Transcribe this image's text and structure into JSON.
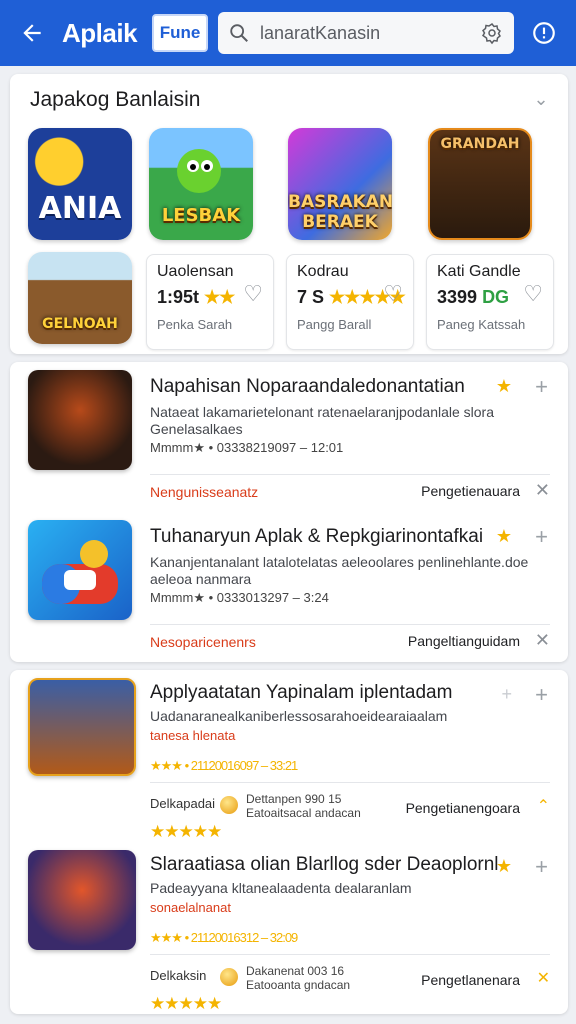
{
  "header": {
    "title": "Aplaik",
    "badge": "Fune",
    "search_placeholder": "lanaratKanasin"
  },
  "featured": {
    "title": "Japakog Banlaisin",
    "tiles": [
      {
        "label": "ANIA"
      },
      {
        "label": "LESBAK"
      },
      {
        "label": "BASRAKAN BERAEK"
      },
      {
        "label": "GRANDAH"
      },
      {
        "label": "GELNOAH"
      }
    ],
    "mini_cards": [
      {
        "name": "Uaolensan",
        "price": "1:95t",
        "stars": "★★",
        "sub": "Penka Sarah"
      },
      {
        "name": "Kodrau",
        "price": "7 S",
        "stars": "★★★★★",
        "sub": "Pangg Barall"
      },
      {
        "name": "Kati Gandle",
        "price": "3399",
        "extra": "DG",
        "sub": "Paneg Katssah"
      }
    ]
  },
  "list1": {
    "items": [
      {
        "title": "Napahisan Noparaandaledonantatian",
        "desc1": "Nataeat lakamarietelonant ratenaelaranjpodanlale slora",
        "desc2": "Genelasalkaes",
        "meta": "Mmmm★ • 03338219097 – 12:01",
        "foot_left": "Nengunisseanatz",
        "foot_right": "Pengetienauara"
      },
      {
        "title": "Tuhanaryun Aplak & Repkgiarinontafkai",
        "desc1": "Kananjentanalant latalotelatas aeleoolares penlinehlante.doe",
        "desc2": "aeleoa nanmara",
        "meta": "Mmmm★ • 0333013297 – 3:24",
        "foot_left": "Nesoparicenenrs",
        "foot_right": "Pangeltianguidam"
      }
    ]
  },
  "list2": {
    "items": [
      {
        "title": "Applyaatatan Yapinalam iplentadam",
        "desc1": "Uadanaranealkaniberlessosarahoeidearaiaalam",
        "sub": "tanesa hlenata",
        "meta": "★★★ • 21120016097 – 33:21",
        "deal_left": "Delkapadai",
        "deal_mid1": "Dettanpen 990 15",
        "deal_mid2": "Eatoaitsacal andacan",
        "deal_right": "Pengetianengoara",
        "stars": "★★★★★"
      },
      {
        "title": "Slaraatiasa olian Blarllog sder Deaoplornl",
        "desc1": "Padeayyana kltanealaadenta dealaranlam",
        "sub": "sonaelalnanat",
        "meta": "★★★ • 21120016312 – 32:09",
        "deal_left": "Delkaksin",
        "deal_mid1": "Dakanenat 003 16",
        "deal_mid2": "Eatooanta gndacan",
        "deal_right": "Pengetlanenara",
        "stars": "★★★★★"
      }
    ]
  },
  "colors": {
    "header_bg": "#1f5fd6",
    "accent_orange": "#d93c1a",
    "star": "#f4b400"
  }
}
